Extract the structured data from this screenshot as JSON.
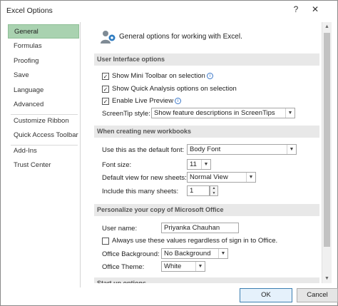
{
  "window": {
    "title": "Excel Options",
    "help_label": "?",
    "close_label": "✕"
  },
  "sidebar": {
    "items": [
      {
        "label": "General"
      },
      {
        "label": "Formulas"
      },
      {
        "label": "Proofing"
      },
      {
        "label": "Save"
      },
      {
        "label": "Language"
      },
      {
        "label": "Advanced"
      },
      {
        "label": "Customize Ribbon"
      },
      {
        "label": "Quick Access Toolbar"
      },
      {
        "label": "Add-Ins"
      },
      {
        "label": "Trust Center"
      }
    ],
    "selected": "General"
  },
  "header": {
    "text": "General options for working with Excel."
  },
  "ui_options": {
    "title": "User Interface options",
    "mini_toolbar": {
      "label": "Show Mini Toolbar on selection",
      "checked": true,
      "mark": "✓"
    },
    "quick_analysis": {
      "label": "Show Quick Analysis options on selection",
      "checked": true,
      "mark": "✓"
    },
    "live_preview": {
      "label": "Enable Live Preview",
      "checked": true,
      "mark": "✓"
    },
    "screentip_label": "ScreenTip style:",
    "screentip_value": "Show feature descriptions in ScreenTips"
  },
  "new_workbooks": {
    "title": "When creating new workbooks",
    "font_label": "Use this as the default font:",
    "font_value": "Body Font",
    "size_label": "Font size:",
    "size_value": "11",
    "view_label": "Default view for new sheets:",
    "view_value": "Normal View",
    "sheets_label": "Include this many sheets:",
    "sheets_value": "1"
  },
  "personalize": {
    "title": "Personalize your copy of Microsoft Office",
    "username_label": "User name:",
    "username_value": "Priyanka Chauhan",
    "always_use": {
      "label": "Always use these values regardless of sign in to Office.",
      "checked": false,
      "mark": ""
    },
    "background_label": "Office Background:",
    "background_value": "No Background",
    "theme_label": "Office Theme:",
    "theme_value": "White"
  },
  "partial_section": {
    "title": "Start up options"
  },
  "footer": {
    "ok_label": "OK",
    "cancel_label": "Cancel"
  },
  "icons": {
    "arrow_down": "▼",
    "arrow_up": "▲",
    "info": "i"
  },
  "colors": {
    "selected_nav": "#a9d2b0",
    "section_bg": "#e8e8e8",
    "default_button_border": "#3c7fb1"
  }
}
